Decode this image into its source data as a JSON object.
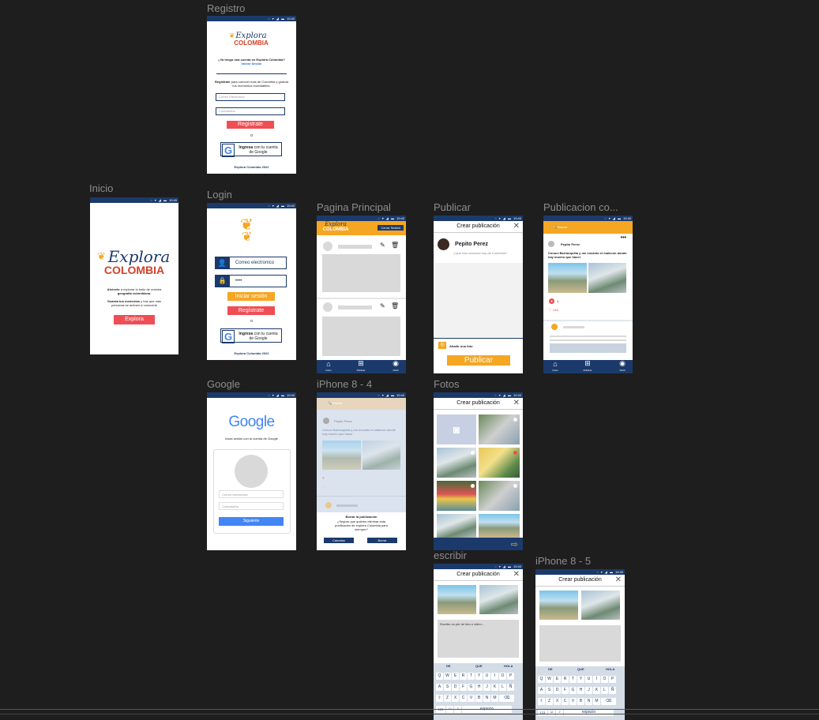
{
  "frames": {
    "registro": {
      "label": "Registro",
      "time": "10:40"
    },
    "inicio": {
      "label": "Inicio",
      "time": "10:40"
    },
    "login": {
      "label": "Login",
      "time": "10:40"
    },
    "pagina_principal": {
      "label": "Pagina Principal",
      "time": "10:40"
    },
    "publicar": {
      "label": "Publicar",
      "time": "10:40"
    },
    "publicacion": {
      "label": "Publicacion co...",
      "time": "10:40"
    },
    "google": {
      "label": "Google",
      "time": "10:40"
    },
    "iphone84": {
      "label": "iPhone 8 - 4",
      "time": "10:40"
    },
    "fotos": {
      "label": "Fotos",
      "time": "10:40"
    },
    "escribir": {
      "label": "escribir",
      "time": "10:40"
    },
    "iphone85": {
      "label": "iPhone 8 - 5",
      "time": "10:40"
    }
  },
  "logo": {
    "explora": "Explora",
    "colombia": "COLOMBIA"
  },
  "registro": {
    "have_account": "¿Ya tengo una cuenta en Explora Colombia?",
    "signin_link": "Iniciar Sesión",
    "intro_bold": "Regístrate",
    "intro_rest": "para conocer más de Colombia y guarda tus momentos inolvidables.",
    "email_placeholder": "Correo Electrónico",
    "password_placeholder": "Contraseña",
    "register_button": "Registrate",
    "or": "o",
    "google_bold": "Ingresa",
    "google_rest": "con tu cuenta de Google",
    "footer": "Explora Colombia 2022"
  },
  "inicio": {
    "line1_a": "Atrévete",
    "line1_b": "a explorar lo bello de nuestra",
    "line1_c": "geografía colombiana.",
    "line2_a": "Guarda tus",
    "line2_b": "memorias",
    "line2_c": "y haz que más personas se animen a conocerla",
    "button": "Explora"
  },
  "login": {
    "email_value": "Correo electronico",
    "password_value": "••••",
    "signin_button": "Iniciar sesión",
    "register_button": "Regístrate",
    "or": "o",
    "google_bold": "Ingresa",
    "google_rest": "con tu cuenta de Google",
    "footer": "Explora Colombia 2022"
  },
  "pagina_principal": {
    "logout_button": "Cerrar Sesión",
    "nav": [
      "Inicio",
      "Publicar",
      "Perfil"
    ]
  },
  "publicar": {
    "header": "Crear publicación",
    "user": "Pepito Perez",
    "placeholder": "¿Que has conocido hoy de Colombia?",
    "add_photo": "Añadir una foto",
    "publish_button": "Publicar"
  },
  "publicacion": {
    "search": "Buscar",
    "user": "Pepito Perez",
    "text": "Conocí Barranquilla y me encanto el malecon donde hay mucho que hacer",
    "likes": "1",
    "like_label": "Like",
    "nav": [
      "Inicio",
      "Publicar",
      "Perfil"
    ]
  },
  "google": {
    "logo": "Google",
    "subtitle": "Inicia sesión con tu cuenta de Google",
    "email_placeholder": "Correo electronico",
    "password_placeholder": "Contraseña",
    "next_button": "Siguiente"
  },
  "iphone84": {
    "search": "Buscar",
    "user": "Pepito Perez",
    "text": "Conocí Barranquilla y me encanto el malecon donde hay mucho que hacer",
    "dialog_title": "Borrar la publicación",
    "dialog_body": "¿Seguro que quieres eliminar esta publicación de explora Colombia para siempre?",
    "cancel": "Cancelar",
    "delete": "Borrar"
  },
  "fotos": {
    "header": "Crear publicación"
  },
  "escribir": {
    "header": "Crear publicación",
    "caption_placeholder": "Escribe un pie de foto o video...",
    "suggestions": [
      "DE",
      "QUE",
      "HOLA"
    ],
    "row1": [
      "Q",
      "W",
      "E",
      "R",
      "T",
      "Y",
      "U",
      "I",
      "O",
      "P"
    ],
    "row2": [
      "A",
      "S",
      "D",
      "F",
      "G",
      "H",
      "J",
      "K",
      "L",
      "Ñ"
    ],
    "row3": [
      "Z",
      "X",
      "C",
      "V",
      "B",
      "N",
      "M"
    ],
    "num": "123",
    "space": "espacio"
  },
  "iphone85": {
    "header": "Crear publicación",
    "suggestions": [
      "DE",
      "QUE",
      "HOLA"
    ],
    "row1": [
      "Q",
      "W",
      "E",
      "R",
      "T",
      "Y",
      "U",
      "I",
      "O",
      "P"
    ],
    "row2": [
      "A",
      "S",
      "D",
      "F",
      "G",
      "H",
      "J",
      "K",
      "L",
      "Ñ"
    ],
    "row3": [
      "Z",
      "X",
      "C",
      "V",
      "B",
      "N",
      "M"
    ],
    "num": "123",
    "space": "espacio"
  }
}
